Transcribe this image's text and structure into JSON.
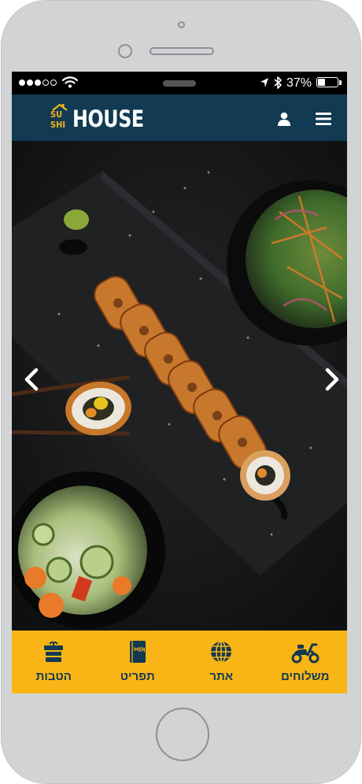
{
  "status_bar": {
    "battery_percent": "37%",
    "battery_level": 0.37,
    "signal_bars_filled": 3,
    "signal_bars_total": 5
  },
  "header": {
    "logo": {
      "su": "SU",
      "shi": "SHI",
      "house": "HOUSE"
    },
    "user_icon": "user-icon",
    "menu_icon": "hamburger-menu-icon"
  },
  "hero": {
    "prev_icon": "chevron-left-icon",
    "next_icon": "chevron-right-icon"
  },
  "bottom_nav": {
    "tabs": [
      {
        "label": "הטבות",
        "icon": "gift-icon"
      },
      {
        "label": "תפריט",
        "icon": "menu-book-icon"
      },
      {
        "label": "אתר",
        "icon": "globe-icon"
      },
      {
        "label": "משלוחים",
        "icon": "scooter-icon"
      }
    ]
  },
  "colors": {
    "header_bg": "#123a52",
    "brand_yellow": "#f9b515",
    "logo_gold": "#f3b31b",
    "nav_text": "#123a52",
    "device_frame": "#d2d3d5"
  }
}
